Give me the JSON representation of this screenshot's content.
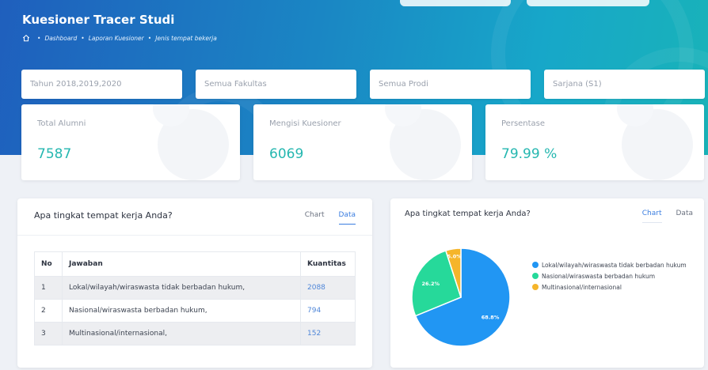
{
  "header": {
    "title": "Kuesioner Tracer Studi",
    "breadcrumb": [
      "Dashboard",
      "Laporan Kuesioner",
      "Jenis tempat bekerja"
    ]
  },
  "filters": {
    "tahun": "Tahun 2018,2019,2020",
    "fakultas": "Semua Fakultas",
    "prodi": "Semua Prodi",
    "jenjang": "Sarjana (S1)"
  },
  "stats": [
    {
      "label": "Total Alumni",
      "value": "7587"
    },
    {
      "label": "Mengisi Kuesioner",
      "value": "6069"
    },
    {
      "label": "Persentase",
      "value": "79.99 %"
    }
  ],
  "table_card": {
    "title": "Apa tingkat tempat kerja Anda?",
    "tab_chart": "Chart",
    "tab_data": "Data",
    "columns": [
      "No",
      "Jawaban",
      "Kuantitas"
    ],
    "rows": [
      {
        "no": "1",
        "jawaban": "Lokal/wilayah/wiraswasta tidak berbadan hukum,",
        "kuantitas": "2088"
      },
      {
        "no": "2",
        "jawaban": "Nasional/wiraswasta berbadan hukum,",
        "kuantitas": "794"
      },
      {
        "no": "3",
        "jawaban": "Multinasional/internasional,",
        "kuantitas": "152"
      }
    ]
  },
  "chart_card": {
    "title": "Apa tingkat tempat kerja Anda?",
    "tab_chart": "Chart",
    "tab_data": "Data"
  },
  "chart_data": {
    "type": "pie",
    "categories": [
      "Lokal/wilayah/wiraswasta tidak berbadan hukum",
      "Nasional/wiraswasta berbadan hukum",
      "Multinasional/internasional"
    ],
    "values": [
      68.8,
      26.2,
      5.0
    ],
    "data_labels": [
      "68.8%",
      "26.2%",
      "5.0%"
    ],
    "colors": [
      "#2196f3",
      "#26d99a",
      "#f5b52b"
    ],
    "legend": "right"
  },
  "colors": {
    "accent": "#25b7b0",
    "link": "#3a7de0"
  }
}
